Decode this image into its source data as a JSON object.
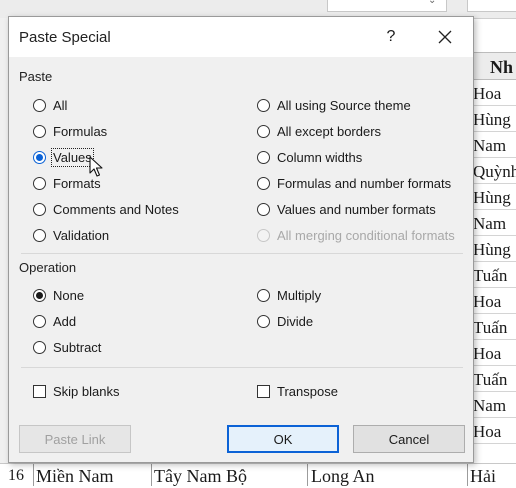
{
  "spreadsheet": {
    "column_header": "Nh",
    "column_cells": [
      "Hoa",
      "Hùng",
      "Nam",
      "Quỳnh",
      "Hùng",
      "Nam",
      "Hùng",
      "Tuấn",
      "Hoa",
      "Tuấn",
      "Hoa",
      "Tuấn",
      "Nam",
      "Hoa"
    ],
    "bottom_row": {
      "row_number": "16",
      "region": "Miền Nam",
      "area": "Tây Nam Bộ",
      "province": "Long An",
      "name": "Hải"
    }
  },
  "dialog": {
    "title": "Paste Special",
    "help_label": "?",
    "close_label": "✕",
    "paste_group": {
      "label": "Paste",
      "left_options": [
        {
          "label": "All",
          "checked": false,
          "disabled": false
        },
        {
          "label": "Formulas",
          "checked": false,
          "disabled": false
        },
        {
          "label": "Values",
          "checked": true,
          "disabled": false
        },
        {
          "label": "Formats",
          "checked": false,
          "disabled": false
        },
        {
          "label": "Comments and Notes",
          "checked": false,
          "disabled": false
        },
        {
          "label": "Validation",
          "checked": false,
          "disabled": false
        }
      ],
      "right_options": [
        {
          "label": "All using Source theme",
          "checked": false,
          "disabled": false
        },
        {
          "label": "All except borders",
          "checked": false,
          "disabled": false
        },
        {
          "label": "Column widths",
          "checked": false,
          "disabled": false
        },
        {
          "label": "Formulas and number formats",
          "checked": false,
          "disabled": false
        },
        {
          "label": "Values and number formats",
          "checked": false,
          "disabled": false
        },
        {
          "label": "All merging conditional formats",
          "checked": false,
          "disabled": true
        }
      ]
    },
    "operation_group": {
      "label": "Operation",
      "left_options": [
        {
          "label": "None",
          "checked": true
        },
        {
          "label": "Add",
          "checked": false
        },
        {
          "label": "Subtract",
          "checked": false
        }
      ],
      "right_options": [
        {
          "label": "Multiply",
          "checked": false
        },
        {
          "label": "Divide",
          "checked": false
        }
      ]
    },
    "checkboxes": {
      "skip_blanks": {
        "label": "Skip blanks",
        "checked": false
      },
      "transpose": {
        "label": "Transpose",
        "checked": false
      }
    },
    "buttons": {
      "paste_link": "Paste Link",
      "ok": "OK",
      "cancel": "Cancel"
    }
  },
  "colors": {
    "accent": "#0b62d6",
    "dialog_bg": "#f0f0f0",
    "disabled_text": "#a8a8a8"
  }
}
